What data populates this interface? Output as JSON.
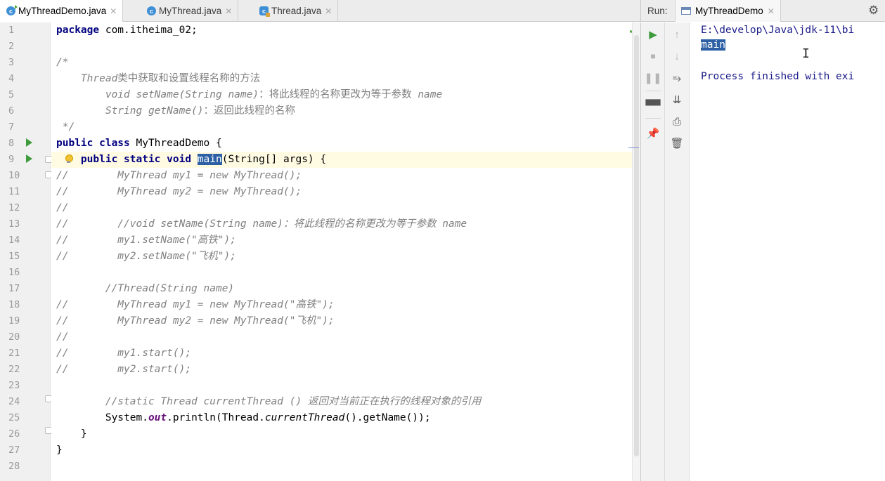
{
  "editor_tabs": [
    {
      "label": "MyThreadDemo.java",
      "icon": "java-class-main-icon",
      "active": true
    },
    {
      "label": "MyThread.java",
      "icon": "java-class-icon",
      "active": false
    },
    {
      "label": "Thread.java",
      "icon": "library-class-icon",
      "active": false
    }
  ],
  "line_numbers": [
    "1",
    "2",
    "3",
    "4",
    "5",
    "6",
    "7",
    "8",
    "9",
    "10",
    "11",
    "12",
    "13",
    "14",
    "15",
    "16",
    "17",
    "18",
    "19",
    "20",
    "21",
    "22",
    "23",
    "24",
    "25",
    "26",
    "27",
    "28"
  ],
  "code": {
    "l1_kw": "package",
    "l1_rest": " com.itheima_02;",
    "l3": "/*",
    "l4_it": "Thread",
    "l4_rest": "类中获取和设置线程名称的方法",
    "l5_it": "void setName(String name)",
    "l5_mid": "：将此线程的名称更改为等于参数 ",
    "l5_end": "name",
    "l6_it": "String getName()",
    "l6_rest": "：返回此线程的名称",
    "l7": " */",
    "l8_kw": "public class",
    "l8_rest": " MyThreadDemo {",
    "l9_kw": "public static void",
    "l9_sel": "main",
    "l9_rest": "(String[] args) {",
    "l10": "//        MyThread my1 = new MyThread();",
    "l11": "//        MyThread my2 = new MyThread();",
    "l12": "//",
    "l13": "//        //void setName(String name)：将此线程的名称更改为等于参数 name",
    "l14": "//        my1.setName(\"高铁\");",
    "l15": "//        my2.setName(\"飞机\");",
    "l17": "        //Thread(String name)",
    "l18": "//        MyThread my1 = new MyThread(\"高铁\");",
    "l19": "//        MyThread my2 = new MyThread(\"飞机\");",
    "l20": "//",
    "l21": "//        my1.start();",
    "l22": "//        my2.start();",
    "l24": "        //static Thread currentThread () 返回对当前正在执行的线程对象的引用",
    "l25_a": "        System.",
    "l25_out": "out",
    "l25_b": ".println(Thread.",
    "l25_ct": "currentThread",
    "l25_c": "().getName());",
    "l26": "    }",
    "l27": "}"
  },
  "run_panel": {
    "label": "Run:",
    "tab": "MyThreadDemo",
    "console_lines": [
      "E:\\develop\\Java\\jdk-11\\bi",
      "main",
      "Process finished with exi"
    ]
  },
  "colors": {
    "keyword": "#000080",
    "comment": "#808080",
    "selection": "#2c5fa3",
    "run_green": "#3e9c3c"
  }
}
